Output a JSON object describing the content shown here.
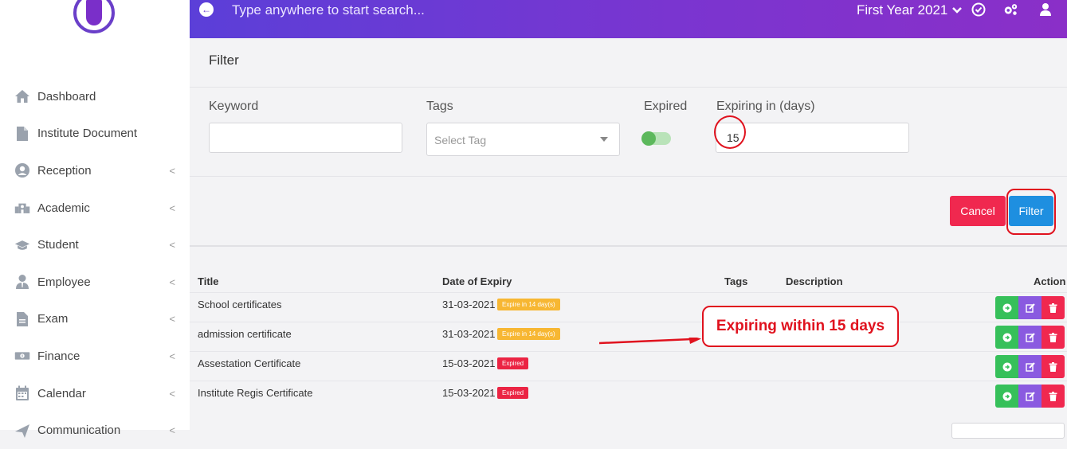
{
  "sidebar": {
    "items": [
      {
        "label": "Dashboard",
        "icon": "home-icon",
        "has_chevron": false
      },
      {
        "label": "Institute Document",
        "icon": "document-icon",
        "has_chevron": false
      },
      {
        "label": "Reception",
        "icon": "user-circle-icon",
        "has_chevron": true
      },
      {
        "label": "Academic",
        "icon": "school-building-icon",
        "has_chevron": true
      },
      {
        "label": "Student",
        "icon": "graduation-cap-icon",
        "has_chevron": true
      },
      {
        "label": "Employee",
        "icon": "employee-icon",
        "has_chevron": true
      },
      {
        "label": "Exam",
        "icon": "exam-file-icon",
        "has_chevron": true
      },
      {
        "label": "Finance",
        "icon": "money-icon",
        "has_chevron": true
      },
      {
        "label": "Calendar",
        "icon": "calendar-icon",
        "has_chevron": true
      },
      {
        "label": "Communication",
        "icon": "send-icon",
        "has_chevron": true
      }
    ],
    "chevron": "<"
  },
  "topbar": {
    "search_placeholder": "Type anywhere to start search...",
    "year_label": "First Year 2021"
  },
  "filter": {
    "title": "Filter",
    "keyword_label": "Keyword",
    "keyword_value": "",
    "tags_label": "Tags",
    "tags_placeholder": "Select Tag",
    "expired_label": "Expired",
    "expired_on": true,
    "expiring_label": "Expiring in (days)",
    "expiring_value": "15",
    "cancel_label": "Cancel",
    "filter_label": "Filter"
  },
  "table": {
    "headers": {
      "title": "Title",
      "date": "Date of Expiry",
      "tags": "Tags",
      "description": "Description",
      "action": "Action"
    },
    "rows": [
      {
        "title": "School certificates",
        "date": "31-03-2021",
        "badge": "Expire in 14 day(s)",
        "status": "warning"
      },
      {
        "title": "admission certificate",
        "date": "31-03-2021",
        "badge": "Expire in 14 day(s)",
        "status": "warning"
      },
      {
        "title": "Assestation Certificate",
        "date": "15-03-2021",
        "badge": "Expired",
        "status": "expired"
      },
      {
        "title": "Institute Regis Certificate",
        "date": "15-03-2021",
        "badge": "Expired",
        "status": "expired"
      }
    ]
  },
  "annotation": {
    "callout_text": "Expiring within 15 days",
    "color": "#e0121e"
  },
  "colors": {
    "topbar_start": "#5b3fd8",
    "topbar_end": "#8a2fc8",
    "cancel": "#f0284f",
    "filter": "#1e8fe0",
    "badge_warning": "#f7b733",
    "badge_expired": "#eb2443",
    "toggle_on": "#5cb85c"
  }
}
